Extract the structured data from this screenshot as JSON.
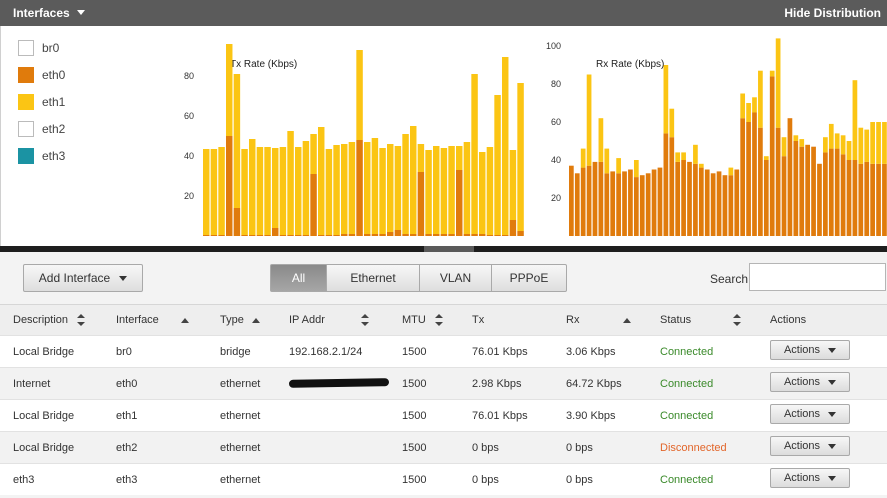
{
  "header": {
    "title": "Interfaces",
    "hide_label": "Hide Distribution"
  },
  "legend": [
    {
      "label": "br0",
      "color": "#ffffff"
    },
    {
      "label": "eth0",
      "color": "#e07b0c"
    },
    {
      "label": "eth1",
      "color": "#fbc514"
    },
    {
      "label": "eth2",
      "color": "#ffffff"
    },
    {
      "label": "eth3",
      "color": "#1b93a3"
    }
  ],
  "chart_data": [
    {
      "type": "bar",
      "title": "Tx Rate (Kbps)",
      "ylim": [
        0,
        100
      ],
      "yticks": [
        20,
        40,
        60,
        80
      ],
      "stacked": true,
      "colors": {
        "eth0": "#e07b0c",
        "eth1": "#fbc514"
      },
      "series": [
        {
          "name": "eth0",
          "values": [
            0.5,
            0.5,
            0.5,
            50,
            14,
            0.5,
            0.5,
            0.5,
            0.5,
            4,
            0.5,
            0.5,
            0.5,
            0.5,
            31,
            0.5,
            0.5,
            0.5,
            1,
            1,
            48,
            1,
            1,
            1,
            2,
            3,
            1,
            1,
            32,
            1,
            1,
            1,
            1,
            33,
            1,
            1,
            1,
            0.5,
            0.5,
            0.5,
            8,
            2.5
          ]
        },
        {
          "name": "eth1",
          "values": [
            43,
            43,
            44,
            46,
            67,
            43,
            48,
            44,
            44,
            40,
            44,
            52,
            44,
            47,
            20,
            54,
            43,
            45,
            45,
            46,
            45,
            46,
            48,
            43,
            44,
            42,
            50,
            54,
            14,
            42,
            44,
            43,
            44,
            12,
            46,
            80,
            41,
            44,
            70,
            89,
            35,
            74
          ]
        }
      ]
    },
    {
      "type": "bar",
      "title": "Rx Rate (Kbps)",
      "ylim": [
        0,
        100
      ],
      "yticks": [
        20,
        40,
        60,
        80,
        100
      ],
      "stacked": true,
      "colors": {
        "eth0": "#e07b0c",
        "eth1": "#fbc514"
      },
      "series": [
        {
          "name": "eth0",
          "values": [
            37,
            33,
            36,
            37,
            39,
            39,
            33,
            34,
            33,
            34,
            35,
            31,
            32,
            33,
            35,
            36,
            54,
            52,
            39,
            40,
            39,
            38,
            36,
            35,
            33,
            34,
            32,
            32,
            35,
            62,
            60,
            65,
            57,
            40,
            84,
            57,
            42,
            62,
            50,
            47,
            48,
            47,
            38,
            44,
            46,
            46,
            43,
            40,
            40,
            38,
            39,
            38,
            38,
            38
          ]
        },
        {
          "name": "eth1",
          "values": [
            0,
            0,
            10,
            48,
            0,
            23,
            13,
            0,
            8,
            0,
            0,
            9,
            0,
            0,
            0,
            0,
            36,
            15,
            5,
            4,
            0,
            10,
            2,
            0,
            0,
            0,
            0,
            4,
            0,
            13,
            10,
            8,
            30,
            2,
            3,
            47,
            10,
            0,
            3,
            4,
            0,
            0,
            0,
            8,
            13,
            8,
            10,
            10,
            42,
            19,
            17,
            22,
            22,
            22
          ]
        }
      ]
    }
  ],
  "toolbar": {
    "add_label": "Add Interface",
    "filters": [
      "All",
      "Ethernet",
      "VLAN",
      "PPPoE"
    ],
    "active_filter": "All",
    "search_label": "Search",
    "search_value": ""
  },
  "table": {
    "columns": [
      "Description",
      "Interface",
      "Type",
      "IP Addr",
      "MTU",
      "Tx",
      "Rx",
      "Status",
      "Actions"
    ],
    "rows": [
      {
        "description": "Local Bridge",
        "interface": "br0",
        "type": "bridge",
        "ip": "192.168.2.1/24",
        "mtu": "1500",
        "tx": "76.01 Kbps",
        "rx": "3.06 Kbps",
        "status": "Connected",
        "status_color": "#3a8a2a",
        "actions": "Actions"
      },
      {
        "description": "Internet",
        "interface": "eth0",
        "type": "ethernet",
        "ip": "",
        "mtu": "1500",
        "tx": "2.98 Kbps",
        "rx": "64.72 Kbps",
        "status": "Connected",
        "status_color": "#3a8a2a",
        "actions": "Actions"
      },
      {
        "description": "Local Bridge",
        "interface": "eth1",
        "type": "ethernet",
        "ip": "",
        "mtu": "1500",
        "tx": "76.01 Kbps",
        "rx": "3.90 Kbps",
        "status": "Connected",
        "status_color": "#3a8a2a",
        "actions": "Actions"
      },
      {
        "description": "Local Bridge",
        "interface": "eth2",
        "type": "ethernet",
        "ip": "",
        "mtu": "1500",
        "tx": "0 bps",
        "rx": "0 bps",
        "status": "Disconnected",
        "status_color": "#e2662b",
        "actions": "Actions"
      },
      {
        "description": "eth3",
        "interface": "eth3",
        "type": "ethernet",
        "ip": "",
        "mtu": "1500",
        "tx": "0 bps",
        "rx": "0 bps",
        "status": "Connected",
        "status_color": "#3a8a2a",
        "actions": "Actions"
      }
    ]
  }
}
